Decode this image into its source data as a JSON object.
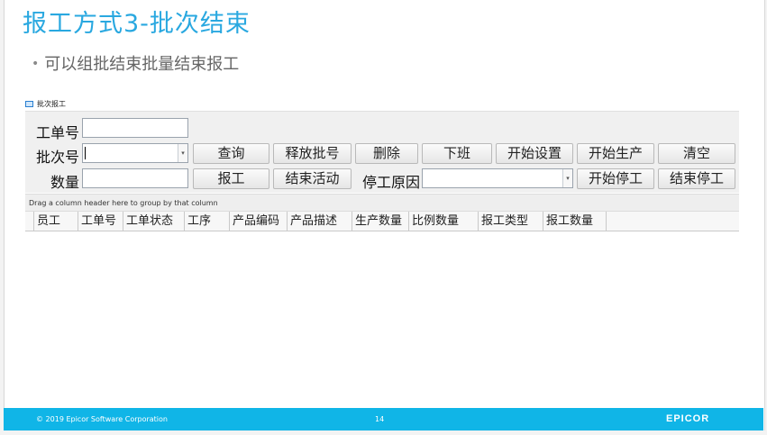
{
  "slide": {
    "title": "报工方式3-批次结束",
    "bullet": "可以组批结束批量结束报工",
    "footer_copyright": "© 2019 Epicor Software Corporation",
    "page_number": "14",
    "logo": "EPICOR"
  },
  "window": {
    "title": "批次报工"
  },
  "form": {
    "labels": {
      "job_no": "工单号",
      "batch_no": "批次号",
      "quantity": "数量",
      "stop_reason": "停工原因"
    },
    "buttons": {
      "query": "查询",
      "release_batch": "释放批号",
      "delete": "删除",
      "off_shift": "下班",
      "start_setup": "开始设置",
      "start_production": "开始生产",
      "clear": "清空",
      "report": "报工",
      "end_activity": "结束活动",
      "start_stop": "开始停工",
      "end_stop": "结束停工"
    }
  },
  "grid": {
    "group_hint": "Drag a column header here to group by that column",
    "columns": [
      "员工",
      "工单号",
      "工单状态",
      "工序",
      "产品编码",
      "产品描述",
      "生产数量",
      "比例数量",
      "报工类型",
      "报工数量"
    ]
  }
}
